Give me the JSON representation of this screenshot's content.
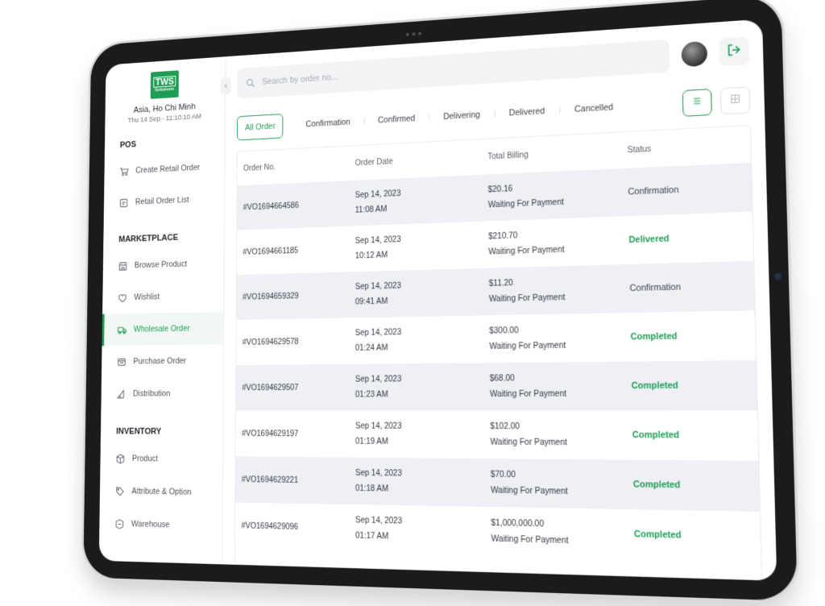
{
  "brand": {
    "logo_line1": "TWS",
    "logo_line2": "Solutions",
    "region": "Asia, Ho Chi Minh",
    "datetime": "Thu 14 Sep - 11:10:10 AM"
  },
  "sidebar": {
    "sections": [
      {
        "title": "POS",
        "items": [
          {
            "label": "Create Retail Order",
            "icon": "cart-icon"
          },
          {
            "label": "Retail Order List",
            "icon": "list-icon"
          }
        ]
      },
      {
        "title": "MARKETPLACE",
        "items": [
          {
            "label": "Browse Product",
            "icon": "store-icon"
          },
          {
            "label": "Wishlist",
            "icon": "heart-icon"
          },
          {
            "label": "Wholesale Order",
            "icon": "truck-icon",
            "active": true
          },
          {
            "label": "Purchase Order",
            "icon": "receipt-icon"
          },
          {
            "label": "Distribution",
            "icon": "distribution-icon"
          }
        ]
      },
      {
        "title": "INVENTORY",
        "items": [
          {
            "label": "Product",
            "icon": "box-icon"
          },
          {
            "label": "Attribute & Option",
            "icon": "tag-icon"
          },
          {
            "label": "Warehouse",
            "icon": "warehouse-icon"
          }
        ]
      }
    ]
  },
  "search": {
    "placeholder": "Search by order no..."
  },
  "tabs": [
    "All Order",
    "Confirmation",
    "Confirmed",
    "Delivering",
    "Delivered",
    "Cancelled"
  ],
  "table": {
    "headers": [
      "Order No.",
      "Order Date",
      "Total Billing",
      "Status"
    ],
    "rows": [
      {
        "order_no": "#VO1694664586",
        "date": "Sep 14, 2023",
        "time": "11:08 AM",
        "amount": "$20.16",
        "billing_status": "Waiting For Payment",
        "status": "Confirmation",
        "status_color": "#3a3f47"
      },
      {
        "order_no": "#VO1694661185",
        "date": "Sep 14, 2023",
        "time": "10:12 AM",
        "amount": "$210.70",
        "billing_status": "Waiting For Payment",
        "status": "Delivered",
        "status_color": "#1f9d55"
      },
      {
        "order_no": "#VO1694659329",
        "date": "Sep 14, 2023",
        "time": "09:41 AM",
        "amount": "$11.20",
        "billing_status": "Waiting For Payment",
        "status": "Confirmation",
        "status_color": "#3a3f47"
      },
      {
        "order_no": "#VO1694629578",
        "date": "Sep 14, 2023",
        "time": "01:24 AM",
        "amount": "$300.00",
        "billing_status": "Waiting For Payment",
        "status": "Completed",
        "status_color": "#1f9d55"
      },
      {
        "order_no": "#VO1694629507",
        "date": "Sep 14, 2023",
        "time": "01:23 AM",
        "amount": "$68.00",
        "billing_status": "Waiting For Payment",
        "status": "Completed",
        "status_color": "#1f9d55"
      },
      {
        "order_no": "#VO1694629197",
        "date": "Sep 14, 2023",
        "time": "01:19 AM",
        "amount": "$102.00",
        "billing_status": "Waiting For Payment",
        "status": "Completed",
        "status_color": "#1f9d55"
      },
      {
        "order_no": "#VO1694629221",
        "date": "Sep 14, 2023",
        "time": "01:18 AM",
        "amount": "$70.00",
        "billing_status": "Waiting For Payment",
        "status": "Completed",
        "status_color": "#1f9d55"
      },
      {
        "order_no": "#VO1694629096",
        "date": "Sep 14, 2023",
        "time": "01:17 AM",
        "amount": "$1,000,000.00",
        "billing_status": "Waiting For Payment",
        "status": "Completed",
        "status_color": "#1f9d55"
      }
    ]
  },
  "colors": {
    "accent": "#1f9d55",
    "row_alt": "#eef0f5"
  }
}
